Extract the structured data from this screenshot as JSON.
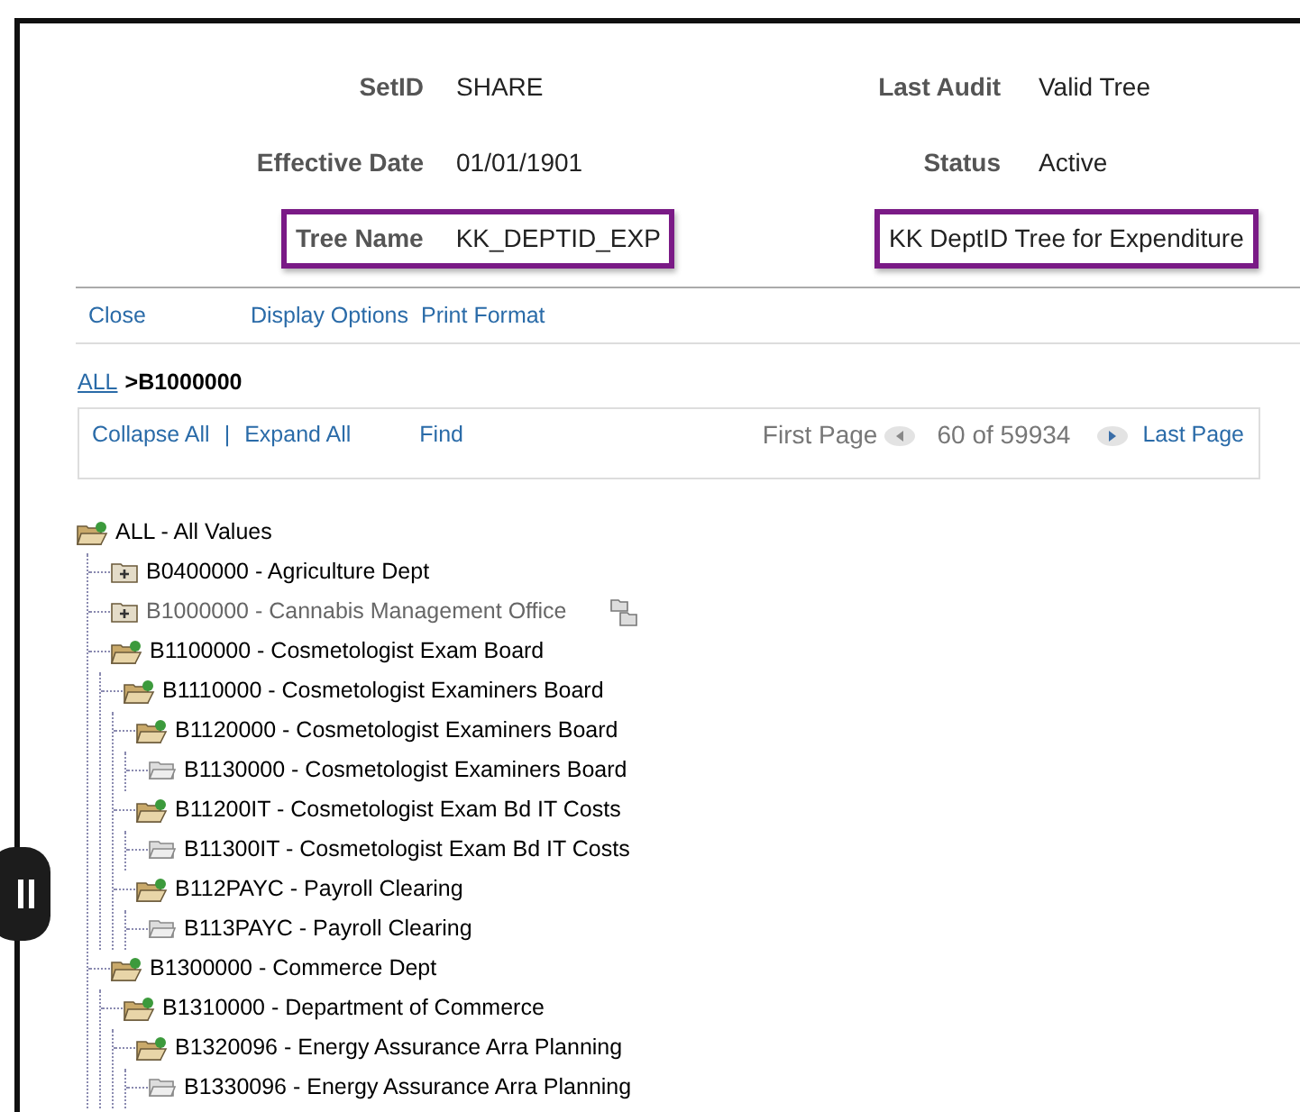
{
  "header": {
    "rows": [
      {
        "left": {
          "label": "SetID",
          "value": "SHARE",
          "highlighted": false
        },
        "right": {
          "label": "Last Audit",
          "value": "Valid Tree",
          "highlighted": false
        }
      },
      {
        "left": {
          "label": "Effective Date",
          "value": "01/01/1901",
          "highlighted": false
        },
        "right": {
          "label": "Status",
          "value": "Active",
          "highlighted": false
        }
      },
      {
        "left": {
          "label": "Tree Name",
          "value": "KK_DEPTID_EXP",
          "highlighted": true
        },
        "right": {
          "value": "KK DeptID Tree for Expenditure",
          "highlighted": true
        }
      }
    ]
  },
  "actions": [
    "Close",
    "Display Options",
    "Print Format"
  ],
  "breadcrumb": {
    "link": "ALL",
    "separator": ">",
    "current": "B1000000"
  },
  "toolbar": {
    "collapse": "Collapse All",
    "separator": "|",
    "expand": "Expand All",
    "find": "Find",
    "first_page": "First Page",
    "first_disabled": true,
    "count": "60 of 59934",
    "last_page": "Last Page",
    "last_disabled": false
  },
  "tree": [
    {
      "label": "ALL - All Values",
      "kind": "open",
      "current": false,
      "children": [
        {
          "label": "B0400000 - Agriculture Dept",
          "kind": "closed",
          "current": false
        },
        {
          "label": "B1000000 - Cannabis Management Office",
          "kind": "closed",
          "current": true
        },
        {
          "label": "B1100000 - Cosmetologist Exam Board",
          "kind": "open",
          "current": false,
          "children": [
            {
              "label": "B1110000 - Cosmetologist Examiners Board",
              "kind": "open",
              "current": false,
              "children": [
                {
                  "label": "B1120000 - Cosmetologist Examiners Board",
                  "kind": "open",
                  "current": false,
                  "children": [
                    {
                      "label": "B1130000 - Cosmetologist Examiners Board",
                      "kind": "leaf",
                      "current": false
                    }
                  ]
                },
                {
                  "label": "B11200IT - Cosmetologist Exam Bd IT Costs",
                  "kind": "open",
                  "current": false,
                  "children": [
                    {
                      "label": "B11300IT - Cosmetologist Exam Bd IT Costs",
                      "kind": "leaf",
                      "current": false
                    }
                  ]
                },
                {
                  "label": "B112PAYC - Payroll Clearing",
                  "kind": "open",
                  "current": false,
                  "children": [
                    {
                      "label": "B113PAYC - Payroll Clearing",
                      "kind": "leaf",
                      "current": false
                    }
                  ]
                }
              ]
            }
          ]
        },
        {
          "label": "B1300000 - Commerce Dept",
          "kind": "open",
          "current": false,
          "children": [
            {
              "label": "B1310000 - Department of Commerce",
              "kind": "open",
              "current": false,
              "children": [
                {
                  "label": "B1320096 - Energy Assurance Arra Planning",
                  "kind": "open",
                  "current": false,
                  "children": [
                    {
                      "label": "B1330096 - Energy Assurance Arra Planning",
                      "kind": "leaf",
                      "current": false
                    }
                  ]
                }
              ]
            }
          ]
        }
      ]
    }
  ]
}
